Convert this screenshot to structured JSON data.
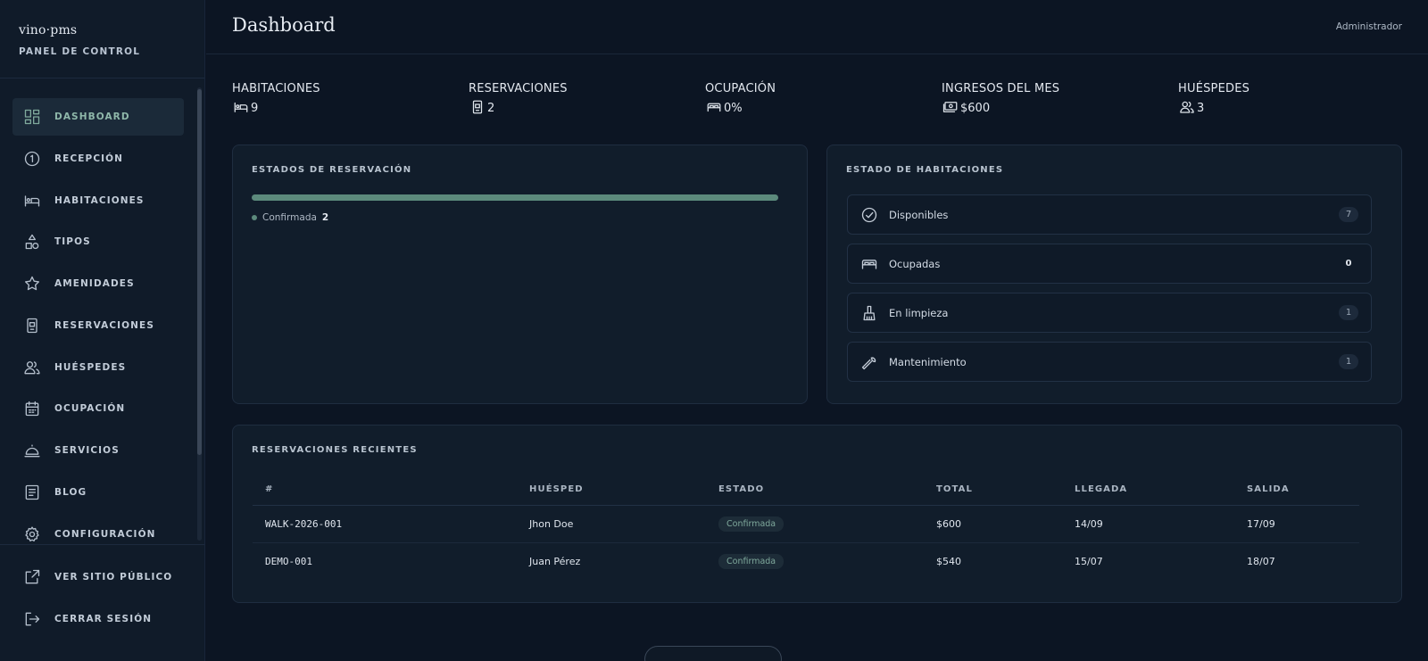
{
  "brand": {
    "name": "vino·pms",
    "subtitle": "PANEL DE CONTROL"
  },
  "header": {
    "title": "Dashboard",
    "user": "Administrador"
  },
  "sidebar": {
    "items": [
      {
        "label": "DASHBOARD",
        "icon": "dashboard-icon",
        "active": true
      },
      {
        "label": "RECEPCIÓN",
        "icon": "reception-icon"
      },
      {
        "label": "HABITACIONES",
        "icon": "bed-icon"
      },
      {
        "label": "TIPOS",
        "icon": "shapes-icon"
      },
      {
        "label": "AMENIDADES",
        "icon": "star-icon"
      },
      {
        "label": "RESERVACIONES",
        "icon": "booking-icon"
      },
      {
        "label": "HUÉSPEDES",
        "icon": "users-icon"
      },
      {
        "label": "OCUPACIÓN",
        "icon": "calendar-icon"
      },
      {
        "label": "SERVICIOS",
        "icon": "cloche-icon"
      },
      {
        "label": "BLOG",
        "icon": "document-icon"
      },
      {
        "label": "CONFIGURACIÓN",
        "icon": "gear-icon"
      }
    ],
    "bottom_items": [
      {
        "label": "VER SITIO PÚBLICO",
        "icon": "external-link-icon"
      },
      {
        "label": "CERRAR SESIÓN",
        "icon": "logout-icon"
      }
    ]
  },
  "stats": [
    {
      "label": "HABITACIONES",
      "value": "9",
      "icon": "bed-icon"
    },
    {
      "label": "RESERVACIONES",
      "value": "2",
      "icon": "booking-icon"
    },
    {
      "label": "OCUPACIÓN",
      "value": "0%",
      "icon": "bed-icon"
    },
    {
      "label": "INGRESOS DEL MES",
      "value": "$600",
      "icon": "money-icon"
    },
    {
      "label": "HUÉSPEDES",
      "value": "3",
      "icon": "users-icon"
    }
  ],
  "reservation_states": {
    "title": "ESTADOS DE RESERVACIÓN",
    "legend": [
      {
        "label": "Confirmada",
        "count": "2",
        "color": "#5c8a7c"
      }
    ]
  },
  "room_states": {
    "title": "ESTADO DE HABITACIONES",
    "items": [
      {
        "label": "Disponibles",
        "count": "7",
        "icon": "check-circle-icon"
      },
      {
        "label": "Ocupadas",
        "count": "0",
        "icon": "bed-icon"
      },
      {
        "label": "En limpieza",
        "count": "1",
        "icon": "broom-icon"
      },
      {
        "label": "Mantenimiento",
        "count": "1",
        "icon": "wrench-icon"
      }
    ]
  },
  "recent": {
    "title": "RESERVACIONES RECIENTES",
    "columns": [
      "#",
      "HUÉSPED",
      "ESTADO",
      "TOTAL",
      "LLEGADA",
      "SALIDA"
    ],
    "rows": [
      {
        "code": "WALK-2026-001",
        "guest": "Jhon Doe",
        "status": "Confirmada",
        "total": "$600",
        "arrival": "14/09",
        "departure": "17/09"
      },
      {
        "code": "DEMO-001",
        "guest": "Juan Pérez",
        "status": "Confirmada",
        "total": "$540",
        "arrival": "15/07",
        "departure": "18/07"
      }
    ]
  },
  "colors": {
    "accent": "#5c8a7c",
    "background": "#0c1523",
    "panel": "#111d2b"
  }
}
